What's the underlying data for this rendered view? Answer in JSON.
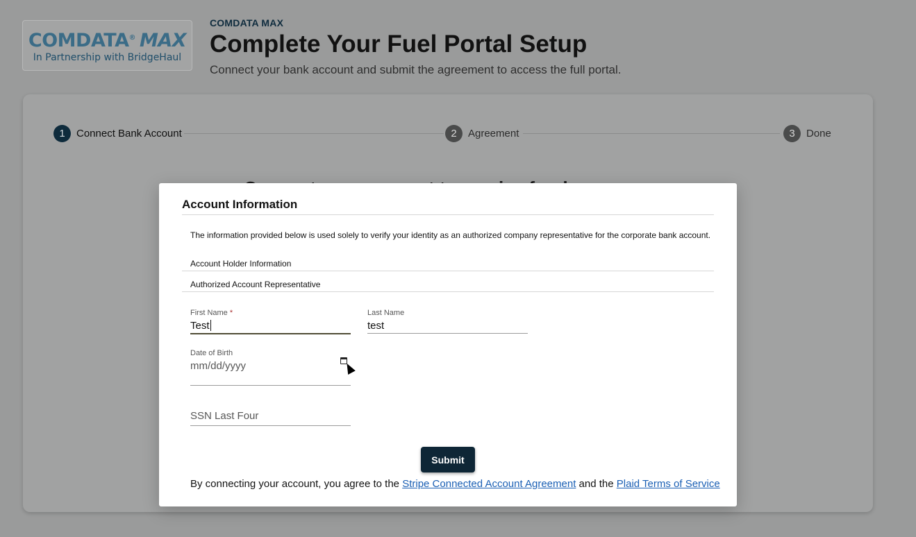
{
  "header": {
    "logo_main": "COMDATA",
    "logo_reg": "®",
    "logo_max": "MAX",
    "logo_sub": "In Partnership with BridgeHaul",
    "brand_label": "COMDATA MAX",
    "title": "Complete Your Fuel Portal Setup",
    "subtitle": "Connect your bank account and submit the agreement to access the full portal."
  },
  "stepper": {
    "steps": [
      {
        "number": "1",
        "label": "Connect Bank Account",
        "active": true
      },
      {
        "number": "2",
        "label": "Agreement",
        "active": false
      },
      {
        "number": "3",
        "label": "Done",
        "active": false
      }
    ]
  },
  "background_heading_partial": "Connect your account to receive funds",
  "modal": {
    "title": "Account Information",
    "description": "The information provided below is used solely to verify your identity as an authorized company representative for the corporate bank account.",
    "section_holder": "Account Holder Information",
    "section_rep": "Authorized Account Representative",
    "first_name": {
      "label": "First Name",
      "required_mark": "*",
      "value": "Test"
    },
    "last_name": {
      "label": "Last Name",
      "value": "test"
    },
    "dob": {
      "label": "Date of Birth",
      "placeholder": "mm/dd/yyyy"
    },
    "ssn": {
      "placeholder": "SSN Last Four"
    },
    "submit_label": "Submit",
    "footer": {
      "prefix": "By connecting your account, you agree to the ",
      "link1": "Stripe Connected Account Agreement",
      "middle": " and the ",
      "link2": "Plaid Terms of Service"
    }
  },
  "colors": {
    "primary_dark": "#0e2636",
    "link": "#1a5fb4",
    "logo_blue": "#3b6c87"
  }
}
